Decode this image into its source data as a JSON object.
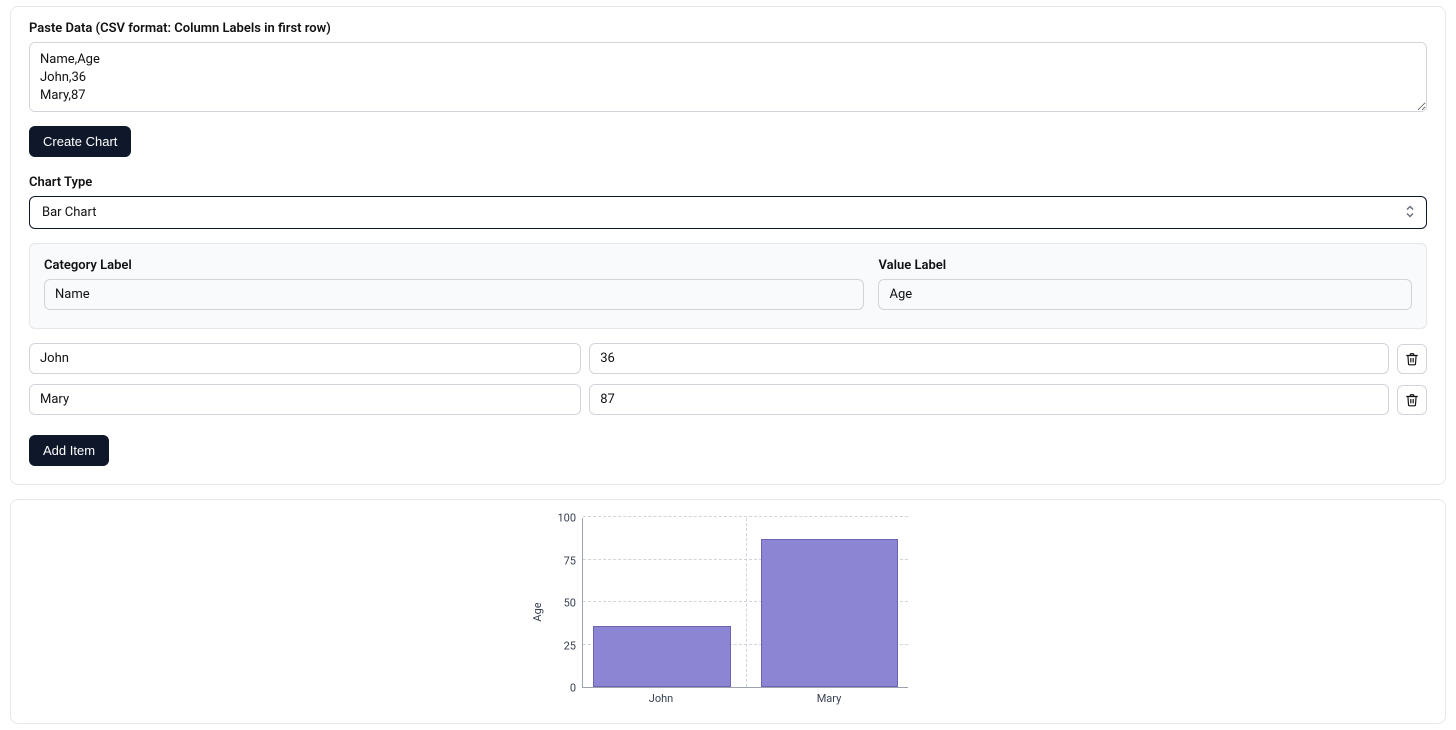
{
  "paste": {
    "label": "Paste Data (CSV format: Column Labels in first row)",
    "value": "Name,Age\nJohn,36\nMary,87"
  },
  "create_chart_label": "Create Chart",
  "chart_type": {
    "label": "Chart Type",
    "selected": "Bar Chart"
  },
  "labels_panel": {
    "category_label_heading": "Category Label",
    "value_label_heading": "Value Label",
    "category_label_value": "Name",
    "value_label_value": "Age"
  },
  "rows": [
    {
      "category": "John",
      "value": "36"
    },
    {
      "category": "Mary",
      "value": "87"
    }
  ],
  "add_item_label": "Add Item",
  "chart_data": {
    "type": "bar",
    "categories": [
      "John",
      "Mary"
    ],
    "values": [
      36,
      87
    ],
    "ylabel": "Age",
    "ylim": [
      0,
      100
    ],
    "yticks": [
      0,
      25,
      50,
      75,
      100
    ]
  },
  "colors": {
    "bar_fill": "#8b85d4",
    "bar_stroke": "#6c63b5",
    "button_bg": "#0f172a"
  }
}
